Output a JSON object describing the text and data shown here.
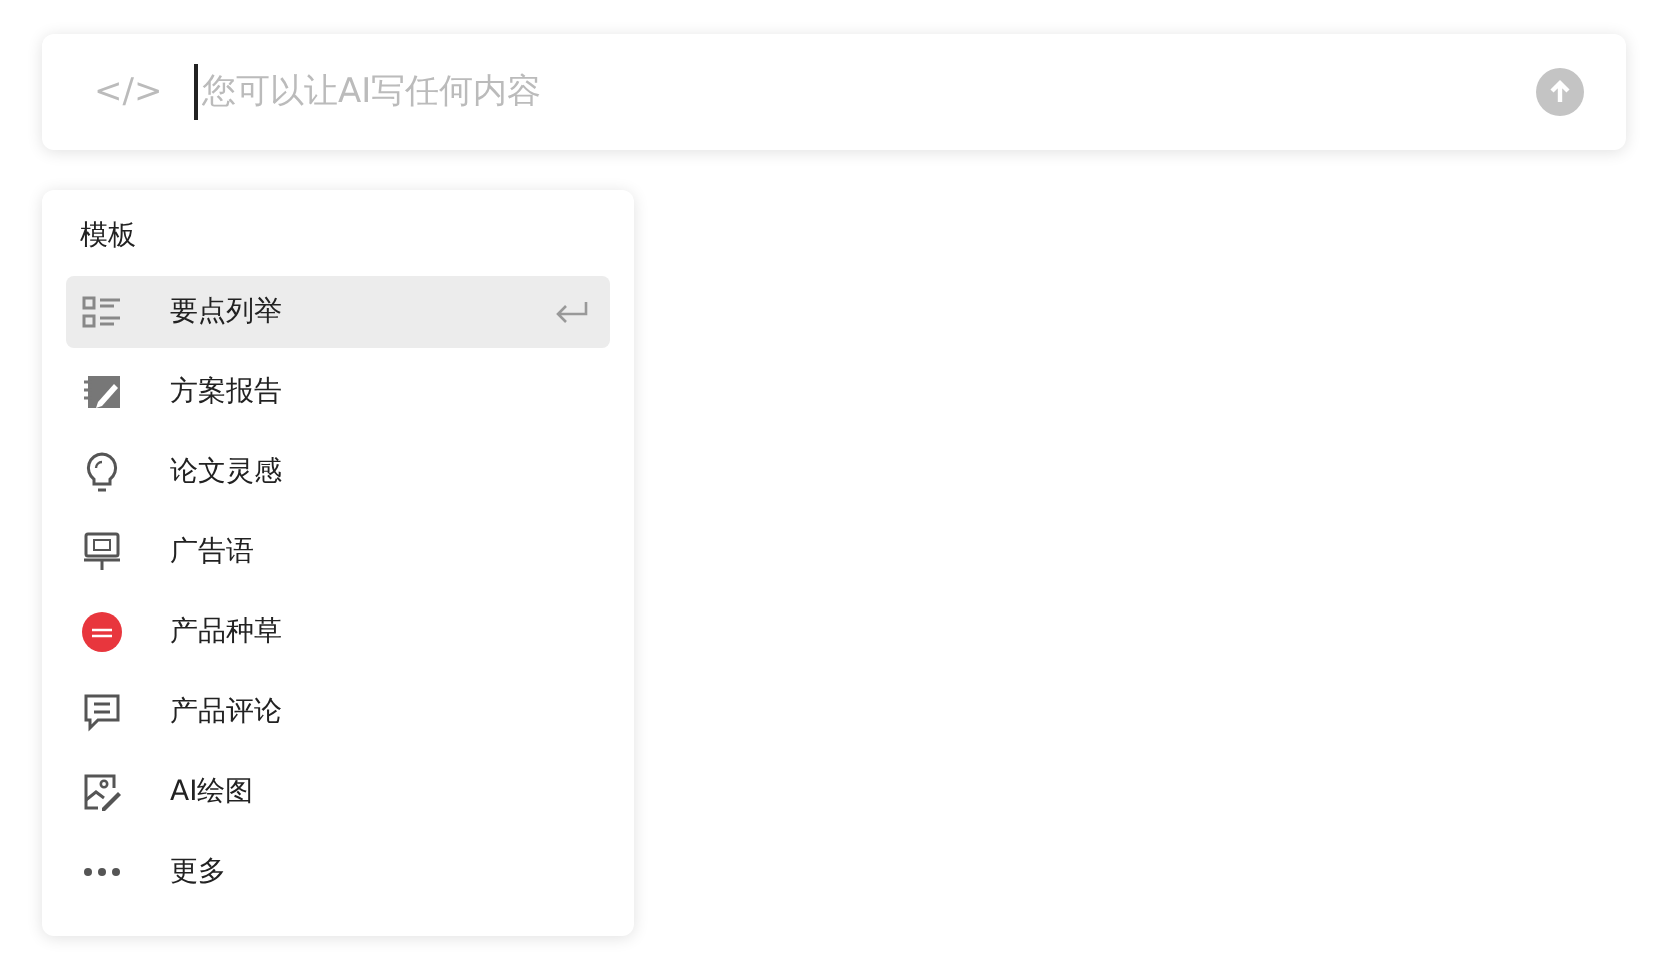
{
  "prompt_bar": {
    "code_glyph": "</>",
    "placeholder": "您可以让AI写任何内容"
  },
  "templates": {
    "title": "模板",
    "items": [
      {
        "label": "要点列举",
        "selected": true
      },
      {
        "label": "方案报告",
        "selected": false
      },
      {
        "label": "论文灵感",
        "selected": false
      },
      {
        "label": "广告语",
        "selected": false
      },
      {
        "label": "产品种草",
        "selected": false
      },
      {
        "label": "产品评论",
        "selected": false
      },
      {
        "label": "AI绘图",
        "selected": false
      },
      {
        "label": "更多",
        "selected": false
      }
    ]
  }
}
